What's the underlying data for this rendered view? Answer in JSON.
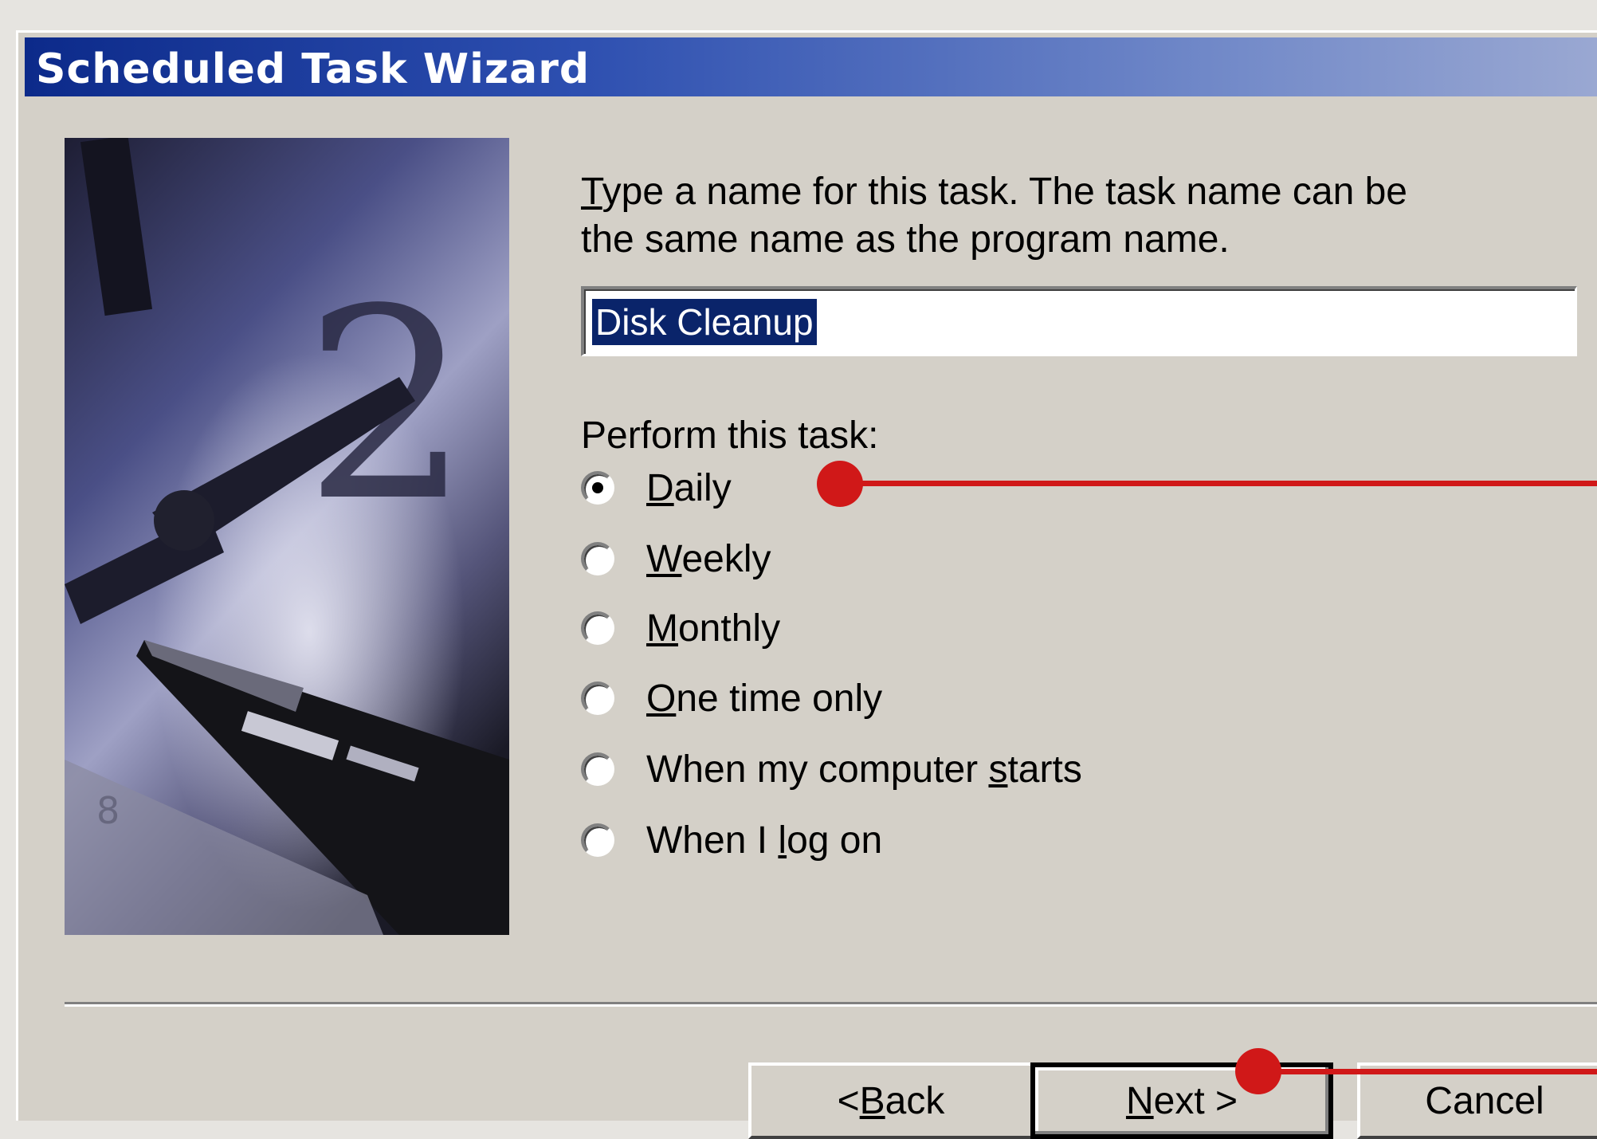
{
  "background_text": [
    "",
    "",
    "",
    "",
    ""
  ],
  "dialog": {
    "title": "Scheduled Task Wizard",
    "instruction_line1_key": "T",
    "instruction_line1_rest": "ype a name for this task.  The task name can be",
    "instruction_line2": "the same name as the program name.",
    "task_name_value": "Disk Cleanup",
    "perform_label": "Perform this task:",
    "options": [
      {
        "key": "D",
        "rest": "aily",
        "checked": true
      },
      {
        "key": "W",
        "rest": "eekly",
        "checked": false
      },
      {
        "key": "M",
        "rest": "onthly",
        "checked": false
      },
      {
        "key": "O",
        "rest": "ne time only",
        "checked": false
      },
      {
        "pre": "When my computer ",
        "key": "s",
        "rest": "tarts",
        "checked": false
      },
      {
        "pre": "When I ",
        "key": "l",
        "rest": "og on",
        "checked": false
      }
    ],
    "buttons": {
      "back_prefix": "< ",
      "back_key": "B",
      "back_rest": "ack",
      "next_key": "N",
      "next_rest": "ext >",
      "cancel": "Cancel"
    }
  },
  "colors": {
    "titlebar_start": "#0c2a8a",
    "selection": "#0a246a",
    "annotation": "#d01818",
    "dialog_face": "#d4d0c8"
  }
}
